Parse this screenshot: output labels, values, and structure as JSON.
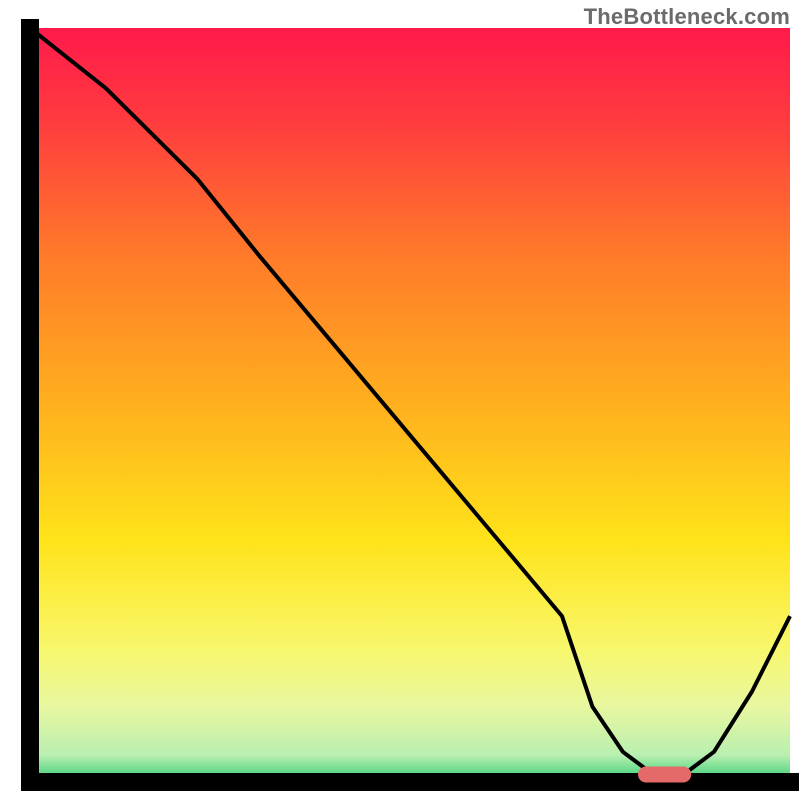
{
  "watermark": {
    "text": "TheBottleneck.com"
  },
  "chart_data": {
    "type": "line",
    "title": "",
    "xlabel": "",
    "ylabel": "",
    "xlim": [
      0,
      100
    ],
    "ylim": [
      0,
      100
    ],
    "grid": false,
    "legend": false,
    "series": [
      {
        "name": "bottleneck-curve",
        "x": [
          0,
          5,
          10,
          22,
          30,
          40,
          50,
          60,
          70,
          74,
          78,
          82,
          86,
          90,
          95,
          100
        ],
        "y": [
          100,
          96,
          92,
          80,
          70,
          58,
          46,
          34,
          22,
          10,
          4,
          1,
          1,
          4,
          12,
          22
        ]
      }
    ],
    "optimum_marker": {
      "x_start": 80,
      "x_end": 87,
      "y": 1
    },
    "background_gradient": {
      "stops": [
        {
          "offset": 0.0,
          "color": "#ff1a4b"
        },
        {
          "offset": 0.12,
          "color": "#ff3a3f"
        },
        {
          "offset": 0.3,
          "color": "#ff7a2a"
        },
        {
          "offset": 0.5,
          "color": "#ffb01e"
        },
        {
          "offset": 0.68,
          "color": "#ffe31a"
        },
        {
          "offset": 0.82,
          "color": "#f8f76a"
        },
        {
          "offset": 0.9,
          "color": "#e8f7a0"
        },
        {
          "offset": 0.965,
          "color": "#b9efb0"
        },
        {
          "offset": 1.0,
          "color": "#2ecc71"
        }
      ]
    },
    "frame_color": "#000000",
    "line_color": "#000000",
    "marker_color": "#e46a6a"
  }
}
